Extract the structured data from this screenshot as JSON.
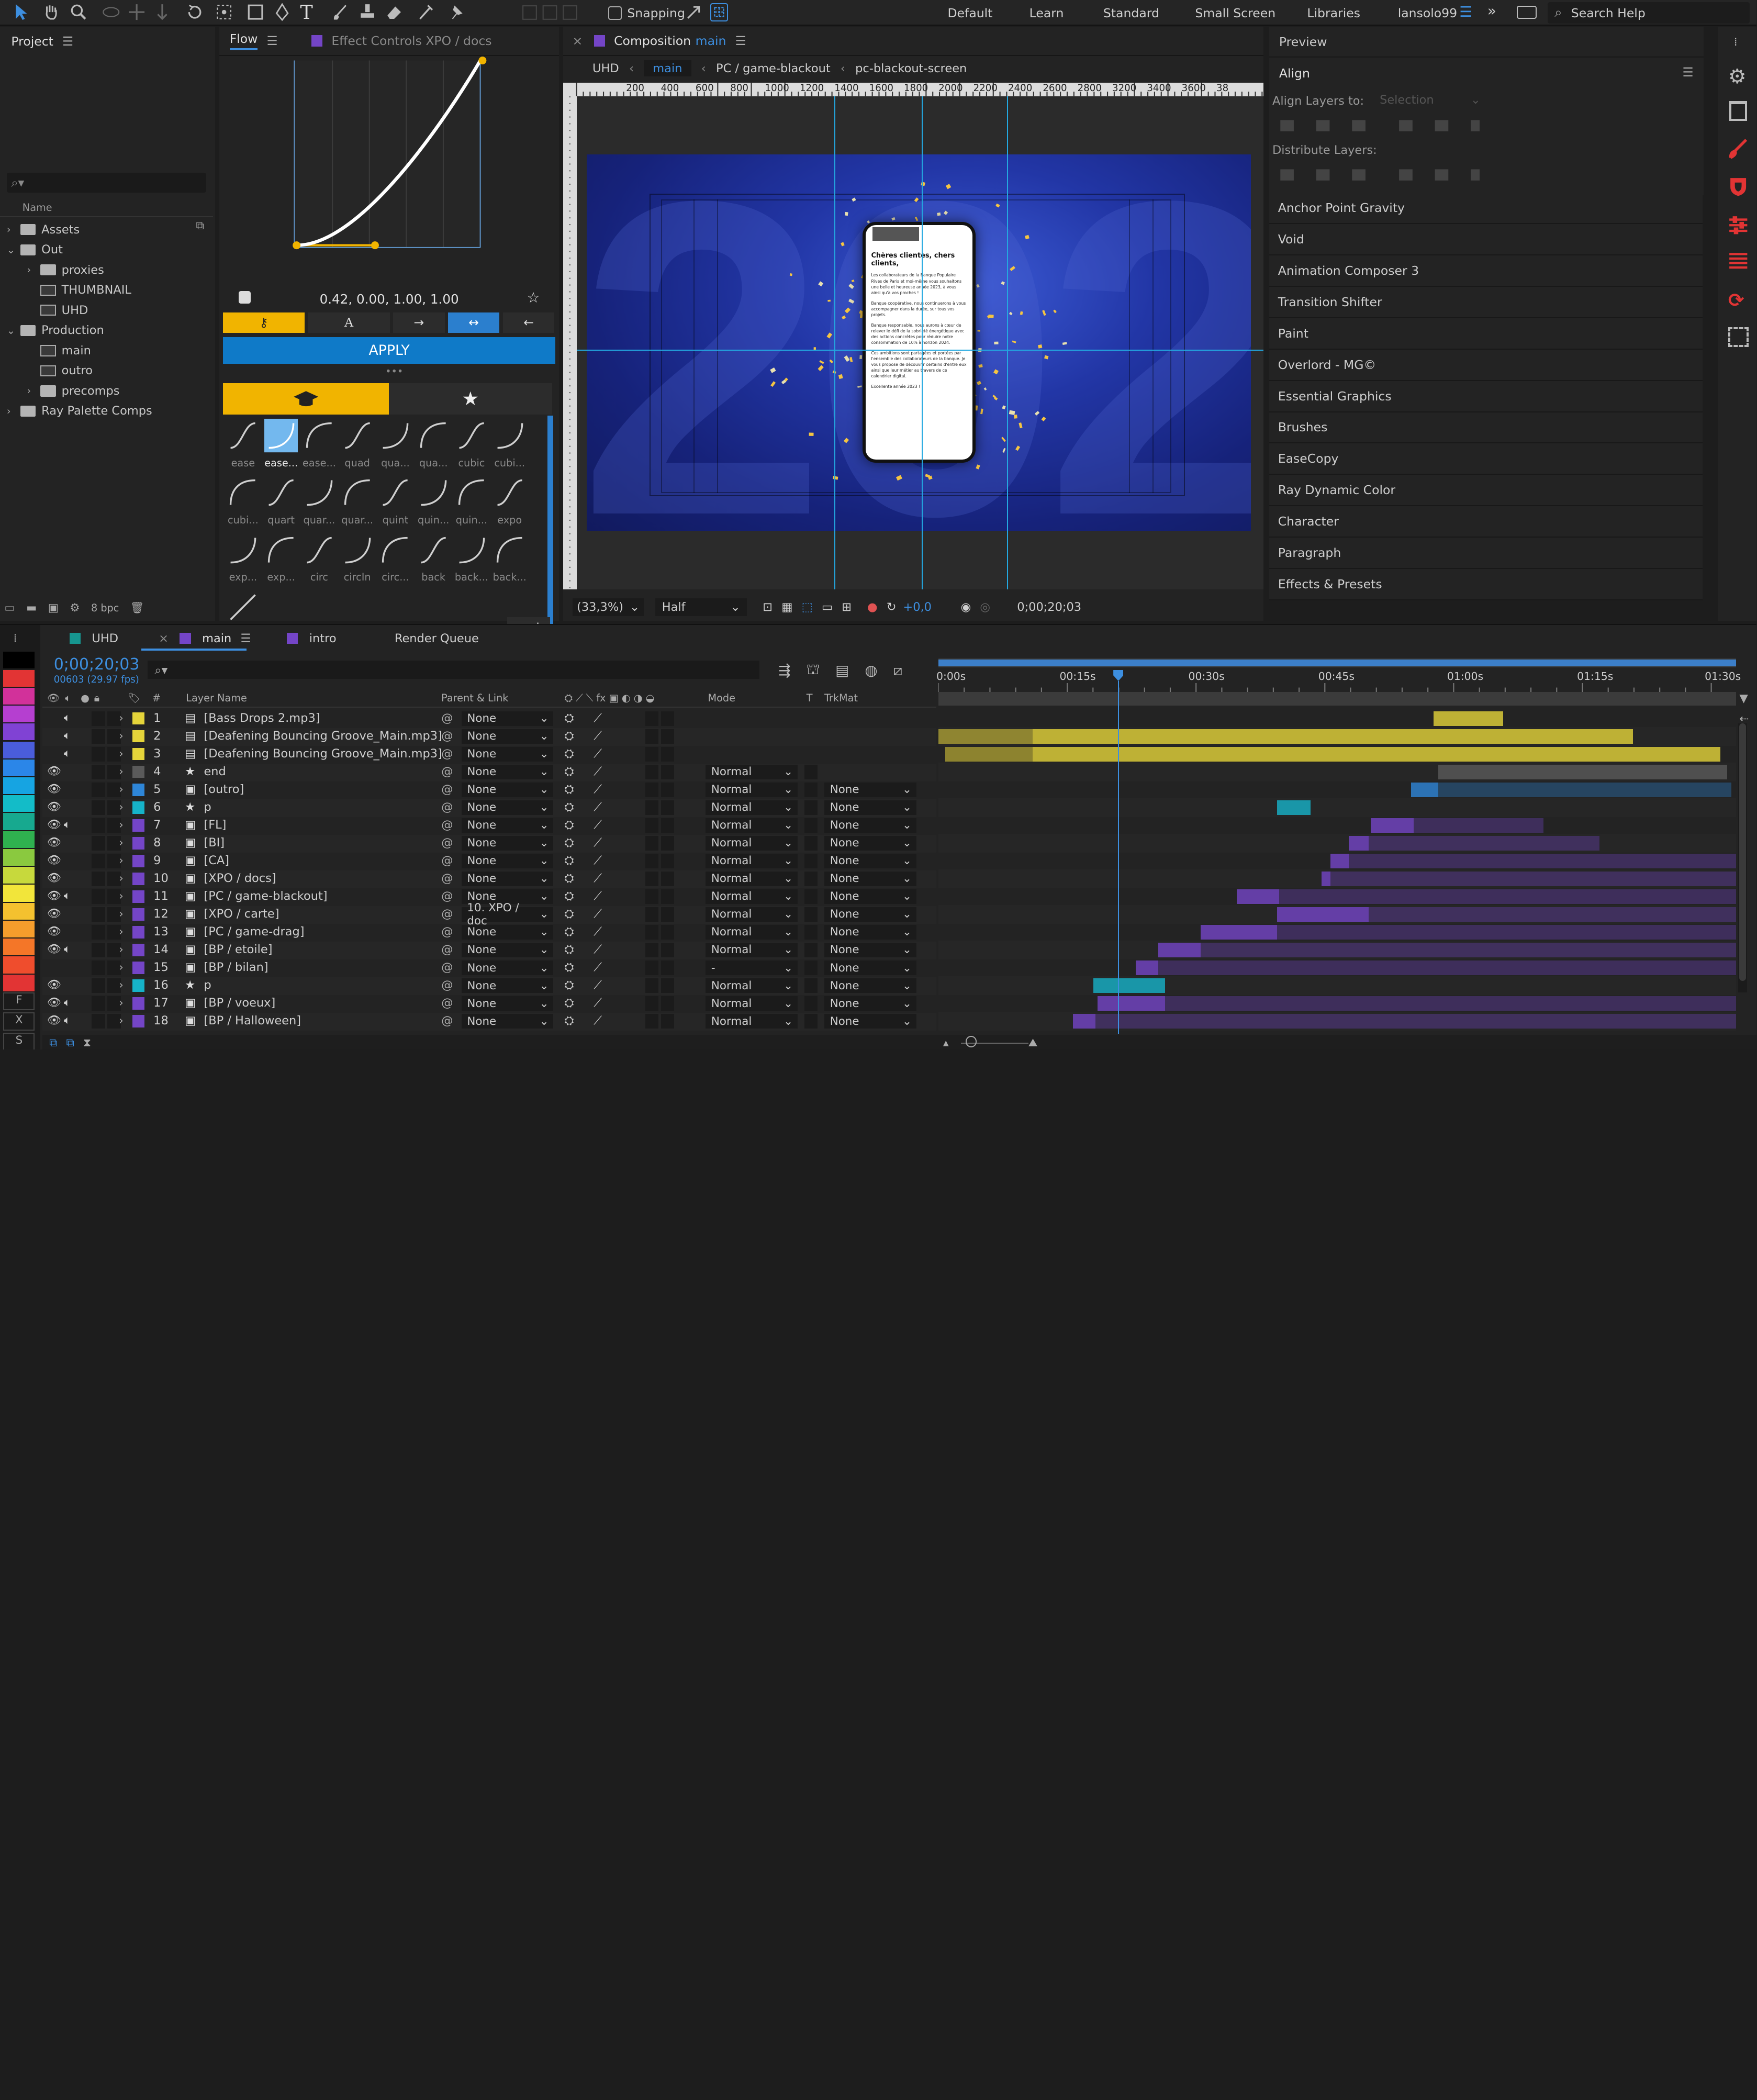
{
  "topbar": {
    "snapping_label": "Snapping",
    "workspaces": [
      "Default",
      "Learn",
      "Standard",
      "Small Screen",
      "Libraries"
    ],
    "user": "lansolo99",
    "search_placeholder": "Search Help"
  },
  "project": {
    "title": "Project",
    "column_name": "Name",
    "bpc": "8 bpc",
    "items": [
      {
        "label": "Assets",
        "type": "folder",
        "indent": 0
      },
      {
        "label": "Out",
        "type": "folder",
        "indent": 0
      },
      {
        "label": "proxies",
        "type": "folder",
        "indent": 1
      },
      {
        "label": "THUMBNAIL",
        "type": "comp",
        "indent": 1
      },
      {
        "label": "UHD",
        "type": "comp",
        "indent": 1
      },
      {
        "label": "Production",
        "type": "folder",
        "indent": 0
      },
      {
        "label": "main",
        "type": "comp",
        "indent": 1
      },
      {
        "label": "outro",
        "type": "comp",
        "indent": 1
      },
      {
        "label": "precomps",
        "type": "folder",
        "indent": 1
      },
      {
        "label": "Ray Palette Comps",
        "type": "folder",
        "indent": 0
      }
    ]
  },
  "flow": {
    "tab": "Flow",
    "tab2": "Effect Controls XPO / docs",
    "values": "0.42, 0.00, 1.00, 1.00",
    "apply": "APPLY",
    "presets": [
      "ease",
      "ease...",
      "ease...",
      "quad",
      "qua...",
      "qua...",
      "cubic",
      "cubi...",
      "cubi...",
      "quart",
      "quar...",
      "quar...",
      "quint",
      "quin...",
      "quin...",
      "expo",
      "exp...",
      "exp...",
      "circ",
      "circIn",
      "circ...",
      "back",
      "back...",
      "back...",
      "linear"
    ],
    "minus": "-",
    "plus": "+"
  },
  "composition": {
    "tab_prefix": "Composition",
    "tab_name": "main",
    "crumbs": [
      "UHD",
      "main",
      "PC / game-blackout",
      "pc-blackout-screen"
    ],
    "ruler": [
      "200",
      "400",
      "600",
      "800",
      "1000",
      "1200",
      "1400",
      "1600",
      "1800",
      "2000",
      "2200",
      "2400",
      "2600",
      "2800",
      "3200",
      "3400",
      "3600",
      "38"
    ],
    "zoom": "(33,3%)",
    "resolution": "Half",
    "exposure": "+0,0",
    "timecode": "0;00;20;03",
    "bg_text": "2023",
    "phone": {
      "greeting": "Chères clientes, chers clients,",
      "p1": "Les collaborateurs de la Banque Populaire Rives de Paris et moi-même vous souhaitons une belle et heureuse année 2023, à vous ainsi qu'à vos proches !",
      "p2": "Banque coopérative, nous continuerons à vous accompagner dans la durée, sur tous vos projets.",
      "p3": "Banque responsable, nous aurons à cœur de relever le défi de la sobriété énergétique avec des actions concrètes pour réduire notre consommation de 10% à horizon 2024.",
      "p4": "Ces ambitions sont partagées et portées par l'ensemble des collaborateurs de la banque. Je vous propose de découvrir certains d'entre eux ainsi que leur métier au travers de ce calendrier digital.",
      "p5": "Excellente année 2023 !"
    }
  },
  "right": {
    "preview": "Preview",
    "align": "Align",
    "align_to_label": "Align Layers to:",
    "align_to_value": "Selection",
    "distribute": "Distribute Layers:",
    "panels": [
      "Anchor Point Gravity",
      "Void",
      "Animation Composer 3",
      "Transition Shifter",
      "Paint",
      "Overlord - MG©",
      "Essential Graphics",
      "Brushes",
      "EaseCopy",
      "Ray Dynamic Color",
      "Character",
      "Paragraph",
      "Effects & Presets"
    ]
  },
  "timeline": {
    "tabs": [
      "UHD",
      "main",
      "intro",
      "Render Queue"
    ],
    "timecode": "0;00;20;03",
    "frames": "00603 (29.97 fps)",
    "headers": {
      "num": "#",
      "name": "Layer Name",
      "parent": "Parent & Link",
      "mode": "Mode",
      "t": "T",
      "trkmat": "TrkMat"
    },
    "time_labels": [
      "0:00s",
      "00:15s",
      "00:30s",
      "00:45s",
      "01:00s",
      "01:15s",
      "01:30s"
    ],
    "layers": [
      {
        "n": "1",
        "name": "[Bass Drops 2.mp3]",
        "color": "#e5d43a",
        "parent": "None",
        "mode": "",
        "trk": "",
        "audio": true,
        "eye": false,
        "icon": "audio"
      },
      {
        "n": "2",
        "name": "[Deafening Bouncing Groove_Main.mp3]",
        "color": "#e5d43a",
        "parent": "None",
        "mode": "",
        "trk": "",
        "audio": true,
        "eye": false,
        "icon": "audio"
      },
      {
        "n": "3",
        "name": "[Deafening Bouncing Groove_Main.mp3]",
        "color": "#e5d43a",
        "parent": "None",
        "mode": "",
        "trk": "",
        "audio": true,
        "eye": false,
        "icon": "audio"
      },
      {
        "n": "4",
        "name": "end",
        "color": "#5a5a5a",
        "parent": "None",
        "mode": "Normal",
        "trk": "",
        "audio": false,
        "eye": true,
        "icon": "star"
      },
      {
        "n": "5",
        "name": "[outro]",
        "color": "#2e86d8",
        "parent": "None",
        "mode": "Normal",
        "trk": "None",
        "audio": false,
        "eye": true,
        "icon": "comp"
      },
      {
        "n": "6",
        "name": "p",
        "color": "#16b3c9",
        "parent": "None",
        "mode": "Normal",
        "trk": "None",
        "audio": false,
        "eye": true,
        "icon": "star"
      },
      {
        "n": "7",
        "name": "[FL]",
        "color": "#7445c7",
        "parent": "None",
        "mode": "Normal",
        "trk": "None",
        "audio": true,
        "eye": true,
        "icon": "comp"
      },
      {
        "n": "8",
        "name": "[BI]",
        "color": "#7445c7",
        "parent": "None",
        "mode": "Normal",
        "trk": "None",
        "audio": false,
        "eye": true,
        "icon": "comp"
      },
      {
        "n": "9",
        "name": "[CA]",
        "color": "#7445c7",
        "parent": "None",
        "mode": "Normal",
        "trk": "None",
        "audio": false,
        "eye": true,
        "icon": "comp"
      },
      {
        "n": "10",
        "name": "[XPO / docs]",
        "color": "#7445c7",
        "parent": "None",
        "mode": "Normal",
        "trk": "None",
        "audio": false,
        "eye": true,
        "icon": "comp"
      },
      {
        "n": "11",
        "name": "[PC / game-blackout]",
        "color": "#7445c7",
        "parent": "None",
        "mode": "Normal",
        "trk": "None",
        "audio": true,
        "eye": true,
        "icon": "comp"
      },
      {
        "n": "12",
        "name": "[XPO / carte]",
        "color": "#7445c7",
        "parent": "10. XPO / doc",
        "mode": "Normal",
        "trk": "None",
        "audio": false,
        "eye": true,
        "icon": "comp"
      },
      {
        "n": "13",
        "name": "[PC / game-drag]",
        "color": "#7445c7",
        "parent": "None",
        "mode": "Normal",
        "trk": "None",
        "audio": false,
        "eye": true,
        "icon": "comp"
      },
      {
        "n": "14",
        "name": "[BP / etoile]",
        "color": "#7445c7",
        "parent": "None",
        "mode": "Normal",
        "trk": "None",
        "audio": true,
        "eye": true,
        "icon": "comp"
      },
      {
        "n": "15",
        "name": "[BP / bilan]",
        "color": "#7445c7",
        "parent": "None",
        "mode": "-",
        "trk": "None",
        "audio": false,
        "eye": false,
        "icon": "comp"
      },
      {
        "n": "16",
        "name": "p",
        "color": "#16b3c9",
        "parent": "None",
        "mode": "Normal",
        "trk": "None",
        "audio": false,
        "eye": true,
        "icon": "star"
      },
      {
        "n": "17",
        "name": "[BP / voeux]",
        "color": "#7445c7",
        "parent": "None",
        "mode": "Normal",
        "trk": "None",
        "audio": true,
        "eye": true,
        "icon": "comp"
      },
      {
        "n": "18",
        "name": "[BP / Halloween]",
        "color": "#7445c7",
        "parent": "None",
        "mode": "Normal",
        "trk": "None",
        "audio": true,
        "eye": true,
        "icon": "comp"
      }
    ],
    "swatch_letters": [
      "F",
      "X",
      "S"
    ]
  }
}
